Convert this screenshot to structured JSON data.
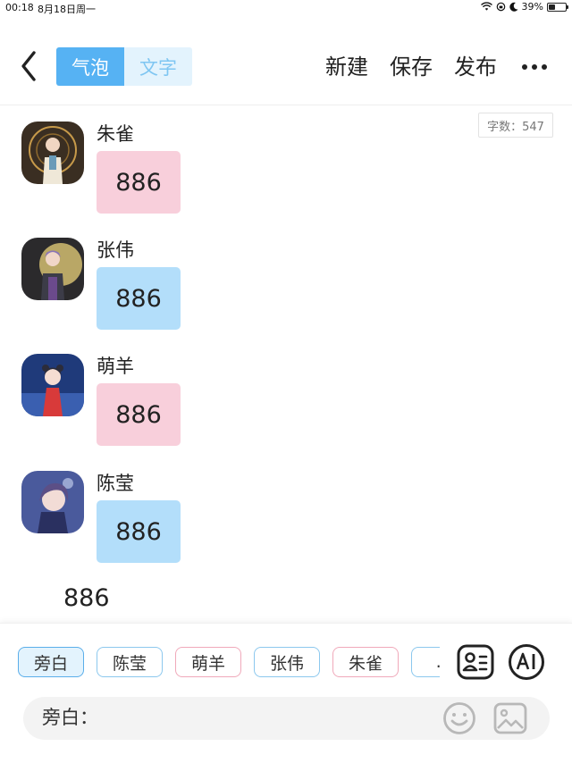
{
  "status_bar": {
    "time": "00:18",
    "date": "8月18日周一",
    "battery": "39%",
    "battery_level": 0.39
  },
  "header": {
    "mode_tabs": [
      {
        "label": "气泡",
        "active": true
      },
      {
        "label": "文字",
        "active": false
      }
    ],
    "actions": [
      "新建",
      "保存",
      "发布"
    ],
    "more_icon": "more-dots-icon",
    "back_icon": "chevron-left-icon"
  },
  "word_count": "字数：547",
  "messages": [
    {
      "name": "朱雀",
      "text": "886",
      "bubble_color": "#f8cfdb"
    },
    {
      "name": "张伟",
      "text": "886",
      "bubble_color": "#b3defa"
    },
    {
      "name": "萌羊",
      "text": "886",
      "bubble_color": "#f8cfdb"
    },
    {
      "name": "陈莹",
      "text": "886",
      "bubble_color": "#b3defa"
    }
  ],
  "narration": "886",
  "chips": [
    {
      "label": "旁白",
      "selected": true,
      "border": "#5aaeea",
      "bg": "#e3f3fd"
    },
    {
      "label": "陈莹",
      "selected": false,
      "border": "#8cc8ee",
      "bg": "#ffffff"
    },
    {
      "label": "萌羊",
      "selected": false,
      "border": "#f0a9ba",
      "bg": "#ffffff"
    },
    {
      "label": "张伟",
      "selected": false,
      "border": "#8cc8ee",
      "bg": "#ffffff"
    },
    {
      "label": "朱雀",
      "selected": false,
      "border": "#f0a9ba",
      "bg": "#ffffff"
    },
    {
      "label": "…",
      "selected": false,
      "border": "#8cc8ee",
      "bg": "#ffffff"
    }
  ],
  "input": {
    "label": "旁白：",
    "value": "",
    "placeholder": ""
  },
  "colors": {
    "accent": "#56b2f3",
    "pink_bubble": "#f8cfdb",
    "blue_bubble": "#b3defa"
  }
}
